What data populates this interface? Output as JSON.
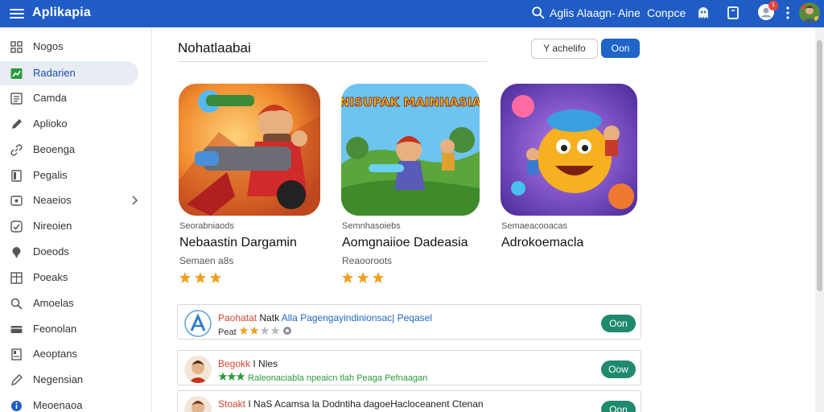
{
  "app": {
    "title": "Aplikapia"
  },
  "topbar": {
    "search_text": "Aglis Alaagn- Aine",
    "compare_label": "Conpce",
    "notification_count": "1"
  },
  "sidebar": {
    "items": [
      {
        "label": "Nogos",
        "icon": "grid-icon"
      },
      {
        "label": "Radarien",
        "icon": "chart-icon",
        "active": true
      },
      {
        "label": "Camda",
        "icon": "list-icon"
      },
      {
        "label": "Aplioko",
        "icon": "edit-icon"
      },
      {
        "label": "Beoenga",
        "icon": "link-icon"
      },
      {
        "label": "Pegalis",
        "icon": "book-icon"
      },
      {
        "label": "Neaeios",
        "icon": "box-icon",
        "has_children": true
      },
      {
        "label": "Nireoien",
        "icon": "check-icon"
      },
      {
        "label": "Doeods",
        "icon": "pin-icon"
      },
      {
        "label": "Poeaks",
        "icon": "table-icon"
      },
      {
        "label": "Amoelas",
        "icon": "magnify-icon"
      },
      {
        "label": "Feonolan",
        "icon": "card-icon"
      },
      {
        "label": "Aeoptans",
        "icon": "document-icon"
      },
      {
        "label": "Negensian",
        "icon": "tag-icon"
      },
      {
        "label": "Meoenaoa",
        "icon": "circle-info-icon"
      }
    ]
  },
  "main": {
    "section_title": "Nohatlaabai",
    "filter_label": "Y achelifo",
    "open_label": "Oon",
    "featured": [
      {
        "category": "Seorabniaods",
        "name": "Nebaastin Dargamin",
        "developer": "Semaen a8s",
        "rating": 3
      },
      {
        "category": "Semnhasoiebs",
        "name": "Aomgnaiioe Dadeasia",
        "developer": "Reaooroots",
        "rating": 3
      },
      {
        "category": "Semaeacooacas",
        "name": "Adrokoemacla",
        "developer": "",
        "rating": 0
      }
    ],
    "banner_text": "NISUPAK MAINHASIA",
    "list": [
      {
        "title_red": "Paohatat",
        "title_black": "Natk",
        "title_blue": "Alla Pagengayindinionsac| Peqasel",
        "meta_label": "Peat",
        "rating": 3,
        "button": "Oon"
      },
      {
        "title_red": "Begokk",
        "title_black": "I Nles",
        "title_green": "Raleonaciabla npeaicn tlah Peaga Pefnaagan",
        "rating": 3,
        "button": "Oow"
      },
      {
        "title_red": "Stoakt",
        "title_black": "I NaS Acamsa la Dodntiha dagoeHacloceanent Ctenan",
        "button": "Oon"
      }
    ]
  },
  "colors": {
    "topbar": "#1f5cc4",
    "accent_button": "#1f64c8",
    "install_button": "#1f8a6e",
    "star": "#f0a020"
  }
}
